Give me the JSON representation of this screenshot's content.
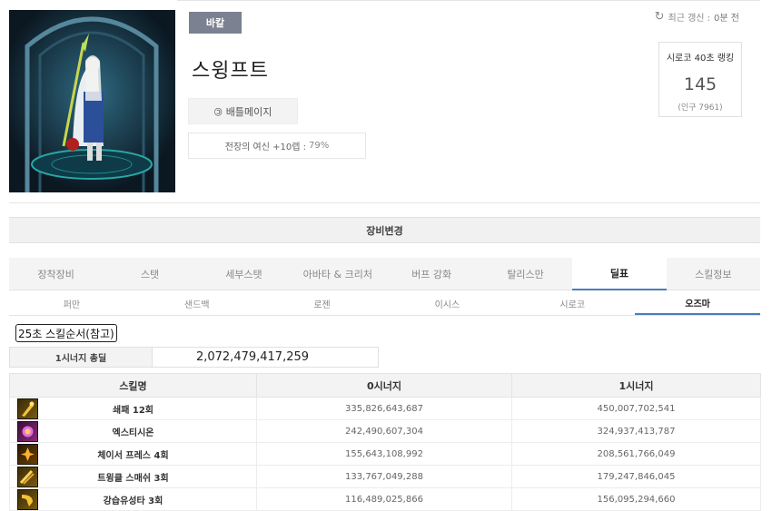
{
  "header": {
    "job": "바칼",
    "character_name": "스윙프트",
    "guild_button": "배틀메이지",
    "adventure": {
      "label": "전장의 여신 +10렙 :",
      "value": "79%"
    },
    "update": {
      "prefix": "최근 갱신 :",
      "value": "0분 전"
    },
    "ranking": {
      "title": "시로코 40초 랭킹",
      "value": "145",
      "population": "(인구 7961)"
    }
  },
  "equip_change_label": "장비변경",
  "main_tabs": [
    "장착장비",
    "스탯",
    "세부스탯",
    "아바타 & 크리처",
    "버프 강화",
    "탈리스만",
    "딜표",
    "스킬정보"
  ],
  "main_tab_active": "딜표",
  "sub_tabs": [
    "퍼만",
    "샌드백",
    "로젠",
    "이시스",
    "시로코",
    "오즈마"
  ],
  "sub_tab_active": "오즈마",
  "rotation_title": "25초 스킬순서(참고)",
  "synergy_total": {
    "label": "1시너지 총딜",
    "value": "2,072,479,417,259"
  },
  "table": {
    "headers": [
      "스킬명",
      "0시너지",
      "1시너지"
    ],
    "rows": [
      {
        "icon": "drill-skill-icon",
        "name": "쇄패 12회",
        "syn0": "335,826,643,687",
        "syn1": "450,007,702,541"
      },
      {
        "icon": "exhaustion-skill-icon",
        "name": "엑스티시온",
        "syn0": "242,490,607,304",
        "syn1": "324,937,413,787"
      },
      {
        "icon": "chaser-skill-icon",
        "name": "체이서 프레스 4회",
        "syn0": "155,643,108,992",
        "syn1": "208,561,766,049"
      },
      {
        "icon": "twinkle-skill-icon",
        "name": "트윙클 스매쉬 3회",
        "syn0": "133,767,049,288",
        "syn1": "179,247,846,045"
      },
      {
        "icon": "comet-skill-icon",
        "name": "강습유성타 3회",
        "syn0": "116,489,025,866",
        "syn1": "156,095,294,660"
      }
    ]
  },
  "colors": {
    "accent": "#4a7dbd",
    "badge": "#7b8191"
  }
}
